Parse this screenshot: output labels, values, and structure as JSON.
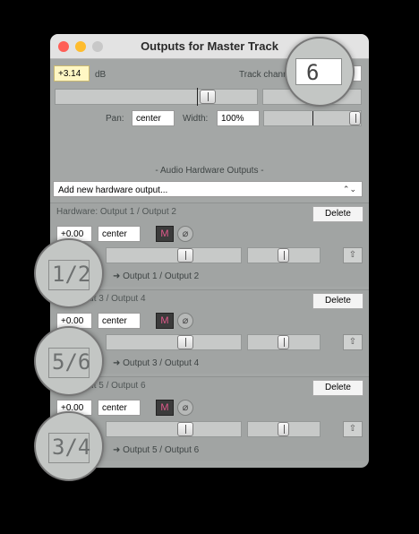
{
  "window": {
    "title": "Outputs for Master Track",
    "gain_value": "+3.14",
    "gain_unit": "dB",
    "track_channel_label": "Track channe",
    "track_channel_value": "6",
    "pan_label": "Pan:",
    "pan_value": "center",
    "width_label": "Width:",
    "width_value": "100%",
    "section_header": "- Audio Hardware Outputs -",
    "add_output_label": "Add new hardware output...",
    "outputs": [
      {
        "header": "Hardware: Output 1 / Output 2",
        "delete": "Delete",
        "gain": "+0.00",
        "pan": "center",
        "mute": "M",
        "phase": "⌀",
        "channel_mag": "1/2",
        "route": "➜ Output 1 / Output 2"
      },
      {
        "header": "re: Output 3 / Output 4",
        "delete": "Delete",
        "gain": "+0.00",
        "pan": "center",
        "mute": "M",
        "phase": "⌀",
        "channel_mag": "5/6",
        "route": "➜ Output 3 / Output 4"
      },
      {
        "header": "re: Output 5 / Output 6",
        "delete": "Delete",
        "gain": "+0.00",
        "pan": "center",
        "mute": "M",
        "phase": "⌀",
        "channel_mag": "3/4",
        "route": "➜ Output 5 / Output 6"
      }
    ]
  },
  "colors": {
    "window_bg": "#a4a7a6",
    "titlebar": "#e3e3e3",
    "close": "#ff5f57",
    "minimize": "#febc2e",
    "zoom": "#c8c8c8",
    "mute": "#e25a8c"
  }
}
